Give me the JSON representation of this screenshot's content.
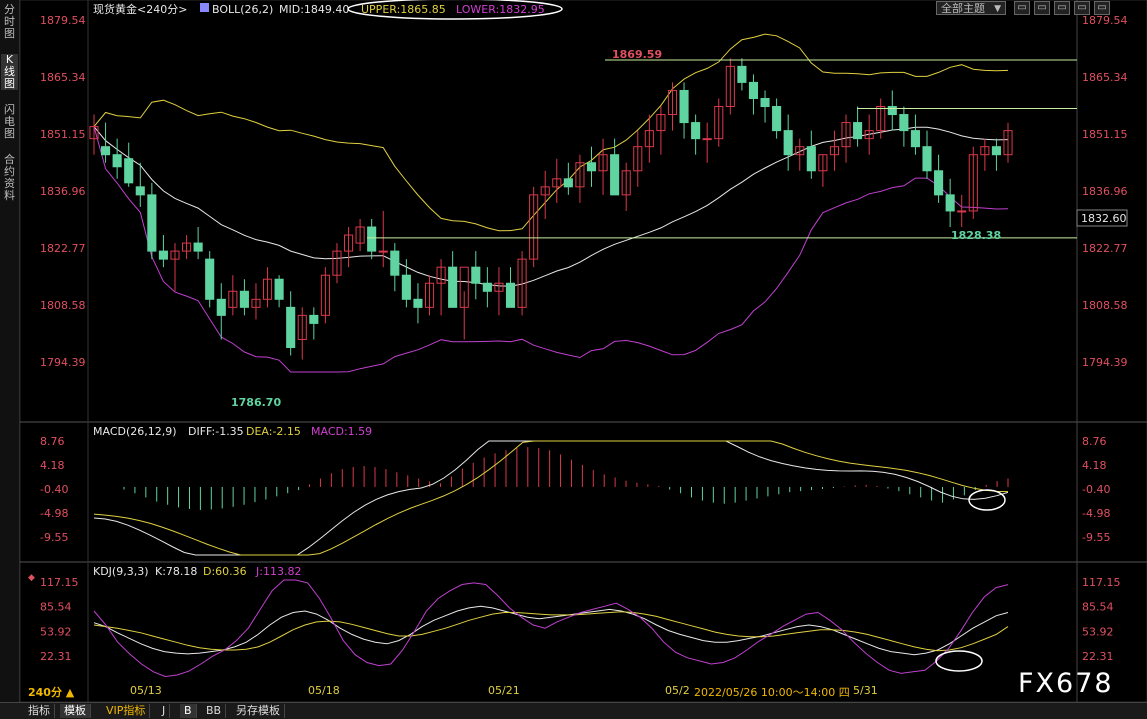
{
  "sidebar": {
    "items": [
      {
        "label": "分时图"
      },
      {
        "label": "K线图"
      },
      {
        "label": "闪电图"
      },
      {
        "label": "合约资料"
      }
    ]
  },
  "header": {
    "symbol": "现货黄金<240分>",
    "boll_label": "BOLL(26,2)",
    "mid_label": "MID:1849.40",
    "upper_label": "UPPER:1865.85",
    "lower_label": "LOWER:1832.95",
    "theme_button": "全部主题",
    "theme_caret": "▼",
    "window_buttons": [
      "▭",
      "▭",
      "▭",
      "▭",
      "▭"
    ]
  },
  "macd_header": {
    "title": "MACD(26,12,9)",
    "diff": "DIFF:-1.35",
    "dea": "DEA:-2.15",
    "macd": "MACD:1.59"
  },
  "kdj_header": {
    "title": "KDJ(9,3,3)",
    "k": "K:78.18",
    "d": "D:60.36",
    "j": "J:113.82"
  },
  "price_axis": {
    "ticks": [
      "1879.54",
      "1865.34",
      "1851.15",
      "1836.96",
      "1822.77",
      "1808.58",
      "1794.39"
    ],
    "current_price": "1832.60"
  },
  "macd_axis": {
    "ticks": [
      "8.76",
      "4.18",
      "-0.40",
      "-4.98",
      "-9.55"
    ]
  },
  "kdj_axis": {
    "ticks": [
      "117.15",
      "85.54",
      "53.92",
      "22.31"
    ]
  },
  "annotations": {
    "high": "1869.59",
    "low": "1786.70",
    "recent_low": "1828.38"
  },
  "x_axis": {
    "labels": [
      "05/13",
      "05/18",
      "05/21",
      "05/2",
      "5/31"
    ]
  },
  "tooltip": "2022/05/26 10:00～14:00 四",
  "period_label": "240分 ▲",
  "watermark": "FX678",
  "bottom_tabs": [
    {
      "label": "指标"
    },
    {
      "label": "模板"
    },
    {
      "label": "VIP指标"
    },
    {
      "label": "J"
    },
    {
      "label": "B"
    },
    {
      "label": "BB"
    },
    {
      "label": "另存模板"
    }
  ],
  "colors": {
    "up": "#d9394a",
    "down": "#5fd4a0",
    "mid": "#e8e8e8",
    "upper": "#e0d040",
    "lower": "#c040d0",
    "label_white": "#e8e8e8",
    "label_yellow": "#e0d040",
    "label_magenta": "#d040d0",
    "axis_red": "#e05060"
  },
  "chart_data": [
    {
      "type": "candlestick",
      "title": "现货黄金<240分>",
      "ylim": [
        1786.7,
        1879.54
      ],
      "x": [
        "05/13",
        "05/18",
        "05/21",
        "05/2",
        "5/31"
      ],
      "candles": [
        [
          1850,
          1856,
          1846,
          1853
        ],
        [
          1848,
          1854,
          1844,
          1846
        ],
        [
          1846,
          1850,
          1840,
          1843
        ],
        [
          1845,
          1849,
          1838,
          1839
        ],
        [
          1838,
          1844,
          1833,
          1836
        ],
        [
          1836,
          1839,
          1820,
          1822
        ],
        [
          1822,
          1826,
          1818,
          1820
        ],
        [
          1820,
          1824,
          1812,
          1822
        ],
        [
          1822,
          1826,
          1820,
          1824
        ],
        [
          1824,
          1828,
          1820,
          1822
        ],
        [
          1820,
          1822,
          1808,
          1810
        ],
        [
          1810,
          1814,
          1800,
          1806
        ],
        [
          1808,
          1816,
          1806,
          1812
        ],
        [
          1812,
          1815,
          1806,
          1808
        ],
        [
          1808,
          1814,
          1805,
          1810
        ],
        [
          1810,
          1818,
          1808,
          1815
        ],
        [
          1815,
          1816,
          1808,
          1810
        ],
        [
          1808,
          1812,
          1796,
          1798
        ],
        [
          1800,
          1808,
          1795,
          1806
        ],
        [
          1806,
          1808,
          1800,
          1804
        ],
        [
          1806,
          1818,
          1804,
          1816
        ],
        [
          1816,
          1824,
          1814,
          1822
        ],
        [
          1822,
          1828,
          1818,
          1826
        ],
        [
          1824,
          1830,
          1822,
          1828
        ],
        [
          1828,
          1830,
          1820,
          1822
        ],
        [
          1822,
          1832,
          1818,
          1822
        ],
        [
          1822,
          1824,
          1812,
          1816
        ],
        [
          1816,
          1820,
          1808,
          1810
        ],
        [
          1810,
          1814,
          1804,
          1808
        ],
        [
          1808,
          1816,
          1806,
          1814
        ],
        [
          1814,
          1820,
          1806,
          1818
        ],
        [
          1818,
          1822,
          1814,
          1808
        ],
        [
          1808,
          1812,
          1800,
          1818
        ],
        [
          1818,
          1822,
          1810,
          1814
        ],
        [
          1814,
          1818,
          1808,
          1812
        ],
        [
          1812,
          1818,
          1806,
          1814
        ],
        [
          1814,
          1818,
          1808,
          1808
        ],
        [
          1808,
          1822,
          1806,
          1820
        ],
        [
          1820,
          1838,
          1818,
          1836
        ],
        [
          1836,
          1842,
          1830,
          1838
        ],
        [
          1838,
          1845,
          1834,
          1840
        ],
        [
          1840,
          1844,
          1836,
          1838
        ],
        [
          1838,
          1846,
          1834,
          1844
        ],
        [
          1844,
          1848,
          1838,
          1842
        ],
        [
          1842,
          1850,
          1836,
          1846
        ],
        [
          1846,
          1850,
          1840,
          1836
        ],
        [
          1836,
          1844,
          1832,
          1842
        ],
        [
          1842,
          1852,
          1838,
          1848
        ],
        [
          1848,
          1856,
          1844,
          1852
        ],
        [
          1852,
          1858,
          1846,
          1856
        ],
        [
          1856,
          1864,
          1852,
          1862
        ],
        [
          1862,
          1864,
          1850,
          1854
        ],
        [
          1854,
          1856,
          1846,
          1850
        ],
        [
          1850,
          1854,
          1844,
          1850
        ],
        [
          1850,
          1860,
          1848,
          1858
        ],
        [
          1858,
          1870,
          1856,
          1868
        ],
        [
          1868,
          1870,
          1862,
          1864
        ],
        [
          1864,
          1866,
          1856,
          1860
        ],
        [
          1860,
          1862,
          1854,
          1858
        ],
        [
          1858,
          1860,
          1850,
          1852
        ],
        [
          1852,
          1856,
          1842,
          1846
        ],
        [
          1846,
          1850,
          1842,
          1848
        ],
        [
          1848,
          1852,
          1840,
          1842
        ],
        [
          1842,
          1846,
          1838,
          1846
        ],
        [
          1846,
          1852,
          1842,
          1848
        ],
        [
          1848,
          1856,
          1844,
          1854
        ],
        [
          1854,
          1858,
          1848,
          1850
        ],
        [
          1850,
          1856,
          1846,
          1852
        ],
        [
          1852,
          1860,
          1850,
          1858
        ],
        [
          1858,
          1862,
          1852,
          1856
        ],
        [
          1856,
          1858,
          1848,
          1852
        ],
        [
          1852,
          1856,
          1846,
          1848
        ],
        [
          1848,
          1852,
          1840,
          1842
        ],
        [
          1842,
          1846,
          1834,
          1836
        ],
        [
          1836,
          1840,
          1828,
          1832
        ],
        [
          1832,
          1836,
          1828,
          1832
        ],
        [
          1832,
          1848,
          1830,
          1846
        ],
        [
          1846,
          1850,
          1842,
          1848
        ],
        [
          1848,
          1850,
          1842,
          1846
        ],
        [
          1846,
          1854,
          1844,
          1852
        ]
      ]
    },
    {
      "type": "bar",
      "title": "MACD(26,12,9)",
      "ylim": [
        -9.55,
        8.76
      ],
      "series": [
        {
          "name": "MACD",
          "values": [
            -0.5,
            -1.2,
            -2.0,
            -2.8,
            -3.4,
            -3.9,
            -4.2,
            -4.4,
            -4.3,
            -4.1,
            -3.8,
            -3.4,
            -2.9,
            -2.4,
            -1.8,
            -1.2,
            -0.6,
            0.5,
            1.6,
            2.6,
            3.4,
            3.8,
            4.0,
            3.8,
            3.4,
            2.8,
            2.2,
            1.6,
            1.1,
            0.7,
            2.0,
            3.5,
            4.6,
            5.6,
            6.4,
            7.0,
            7.4,
            7.6,
            7.4,
            7.0,
            6.2,
            5.2,
            4.2,
            3.2,
            2.4,
            1.8,
            1.2,
            0.8,
            0.5,
            0.2,
            -0.5,
            -1.2,
            -2.0,
            -2.6,
            -3.0,
            -3.2,
            -3.0,
            -2.6,
            -2.2,
            -1.8,
            -1.4,
            -1.0,
            -0.8,
            -0.6,
            -0.4,
            -0.2,
            0.1,
            0.3,
            0.4,
            0.2,
            -0.3,
            -0.8,
            -1.4,
            -2.0,
            -2.6,
            -3.0,
            -2.4,
            -1.6,
            -0.6,
            0.4,
            1.1,
            1.6
          ]
        }
      ]
    },
    {
      "type": "line",
      "title": "KDJ(9,3,3)",
      "ylim": [
        22.31,
        117.15
      ],
      "series": [
        {
          "name": "K",
          "values": [
            65,
            60,
            52,
            45,
            38,
            32,
            28,
            26,
            25,
            26,
            28,
            30,
            34,
            40,
            50,
            62,
            72,
            78,
            80,
            76,
            68,
            58,
            50,
            44,
            40,
            38,
            42,
            50,
            60,
            68,
            74,
            80,
            84,
            86,
            84,
            80,
            76,
            72,
            70,
            72,
            74,
            76,
            78,
            80,
            82,
            80,
            76,
            70,
            62,
            55,
            50,
            46,
            42,
            40,
            40,
            42,
            45,
            48,
            52,
            56,
            60,
            62,
            60,
            56,
            50,
            44,
            38,
            32,
            28,
            26,
            24,
            26,
            30,
            38,
            48,
            58,
            66,
            74,
            78
          ]
        },
        {
          "name": "D",
          "values": [
            62,
            60,
            58,
            55,
            52,
            48,
            44,
            40,
            36,
            33,
            31,
            30,
            30,
            31,
            34,
            40,
            48,
            56,
            62,
            66,
            67,
            66,
            63,
            59,
            55,
            51,
            48,
            48,
            50,
            54,
            58,
            63,
            68,
            72,
            76,
            78,
            78,
            77,
            76,
            75,
            75,
            75,
            76,
            77,
            78,
            79,
            78,
            76,
            73,
            69,
            65,
            61,
            57,
            53,
            50,
            48,
            47,
            47,
            48,
            50,
            52,
            54,
            56,
            56,
            55,
            53,
            50,
            46,
            42,
            38,
            34,
            31,
            29,
            30,
            33,
            38,
            44,
            50,
            60
          ]
        },
        {
          "name": "J",
          "values": [
            80,
            62,
            40,
            25,
            12,
            2,
            -4,
            -2,
            3,
            12,
            22,
            30,
            42,
            58,
            82,
            106,
            120,
            122,
            116,
            96,
            70,
            42,
            24,
            14,
            10,
            12,
            30,
            54,
            80,
            96,
            106,
            114,
            116,
            114,
            100,
            84,
            72,
            62,
            58,
            66,
            72,
            78,
            82,
            86,
            90,
            82,
            72,
            58,
            40,
            27,
            20,
            16,
            12,
            14,
            20,
            30,
            41,
            50,
            60,
            68,
            76,
            78,
            68,
            56,
            40,
            26,
            14,
            4,
            0,
            2,
            4,
            16,
            32,
            54,
            78,
            98,
            110,
            113.82
          ]
        }
      ]
    }
  ]
}
